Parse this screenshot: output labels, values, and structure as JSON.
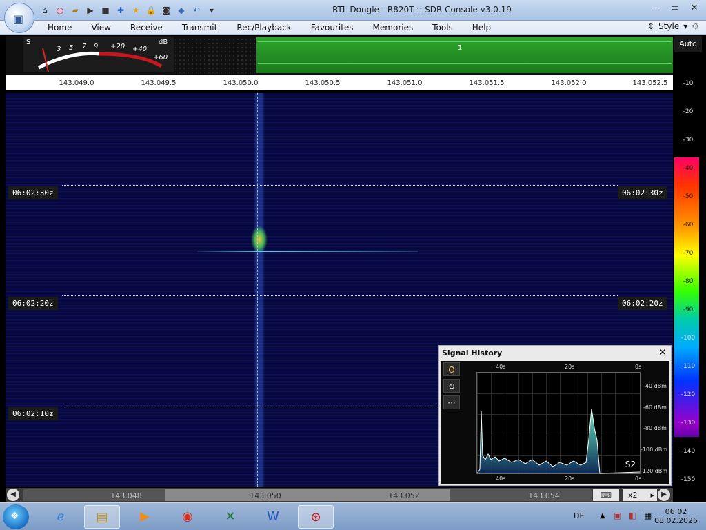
{
  "window": {
    "title": "RTL Dongle - R820T :: SDR Console v3.0.19"
  },
  "quick_access": [
    "home-icon",
    "lifebuoy-icon",
    "folder-icon",
    "play-icon",
    "stop-icon",
    "add-icon",
    "star-icon",
    "lock-icon",
    "camera-icon",
    "drop-icon",
    "undo-icon",
    "dropdown-icon"
  ],
  "menu": {
    "items": [
      "Home",
      "View",
      "Receive",
      "Transmit",
      "Rec/Playback",
      "Favourites",
      "Memories",
      "Tools",
      "Help"
    ],
    "style_label": "Style"
  },
  "smeter": {
    "s_label": "S",
    "db_label": "dB",
    "scale": [
      "3",
      "5",
      "7",
      "9",
      "+20",
      "+40",
      "+60"
    ]
  },
  "band": {
    "marker": "1"
  },
  "freq_axis": [
    "143.049.0",
    "143.049.5",
    "143.050.0",
    "143.050.5",
    "143.051.0",
    "143.051.5",
    "143.052.0",
    "143.052.5"
  ],
  "waterfall": {
    "times": [
      "06:02:30z",
      "06:02:20z",
      "06:02:10z"
    ]
  },
  "dbscale": {
    "auto_label": "Auto",
    "labels": [
      "-10",
      "-20",
      "-30",
      "-40",
      "-50",
      "-60",
      "-70",
      "-80",
      "-90",
      "-100",
      "-110",
      "-120",
      "-130",
      "-140",
      "-150"
    ]
  },
  "bottom_bar": {
    "freqs": [
      "143.048",
      "143.050",
      "143.052",
      "143.054"
    ],
    "zoom": "x2"
  },
  "signal_history": {
    "title": "Signal History",
    "time_top": [
      "40s",
      "20s",
      "0s"
    ],
    "time_bottom": [
      "40s",
      "20s",
      "0s"
    ],
    "dbm": [
      "-40 dBm",
      "-60 dBm",
      "-80 dBm",
      "-100 dBm",
      "-120 dBm"
    ],
    "s_reading": "S2",
    "tools": [
      "O",
      "↻",
      "···"
    ]
  },
  "taskbar": {
    "apps": [
      "ie-icon",
      "explorer-icon",
      "media-player-icon",
      "chrome-icon",
      "excel-icon",
      "word-icon",
      "sdr-console-icon"
    ],
    "lang": "DE",
    "time": "06:02",
    "date": "08.02.2026"
  },
  "colors": {
    "waterfall_bg": "#0a0b4d",
    "band_green": "#2ca42c",
    "taskbar": "#7d9cc6"
  }
}
